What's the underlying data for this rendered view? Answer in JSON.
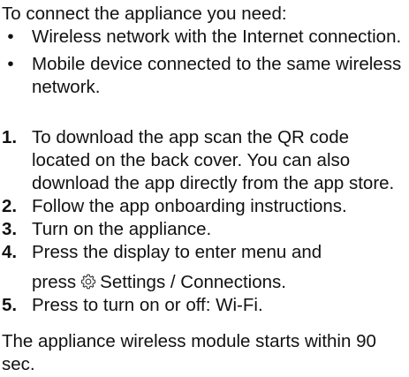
{
  "intro": "To connect the appliance you need:",
  "requirements": [
    "Wireless network with the Internet connection.",
    "Mobile device connected to the same wireless network."
  ],
  "bullet_glyph": "•",
  "steps": [
    {
      "num": "1.",
      "text": "To download the app scan the QR code located on the back cover. You can also download the app directly from the app store."
    },
    {
      "num": "2.",
      "text": "Follow the app onboarding instructions."
    },
    {
      "num": "3.",
      "text": "Turn on the appliance."
    },
    {
      "num": "4.",
      "text_line1": "Press the display to enter menu and",
      "text_pre": "press",
      "icon": "settings-gear-icon",
      "text_post": "Settings / Connections."
    },
    {
      "num": "5.",
      "text": "Press to turn on or off: Wi-Fi."
    }
  ],
  "outro": "The appliance wireless module starts within 90 sec."
}
